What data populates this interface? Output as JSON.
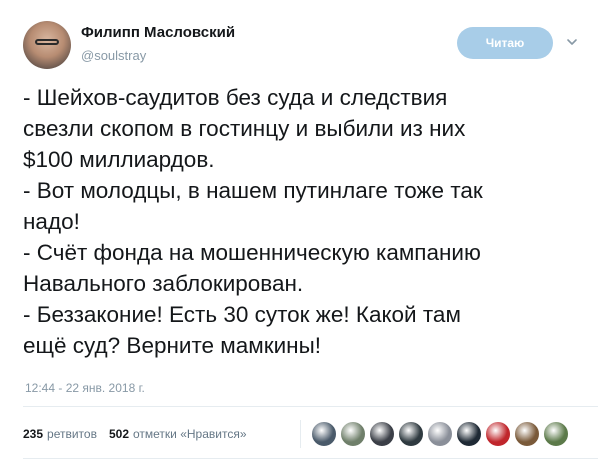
{
  "author": {
    "display_name": "Филипп Масловский",
    "handle": "@soulstray"
  },
  "follow_button": {
    "label": "Читаю"
  },
  "tweet": {
    "lines": [
      "- Шейхов-саудитов без суда и следствия",
      "свезли скопом в гостинцу и выбили из них",
      "$100 миллиардов.",
      "- Вот молодцы, в нашем путинлаге тоже так",
      "надо!",
      "- Счёт фонда на мошенническую кампанию",
      "Навального заблокирован.",
      "- Беззаконие! Есть 30 суток же! Какой там",
      "ещё суд? Верните мамкины!"
    ],
    "timestamp": "12:44 - 22 янв. 2018 г."
  },
  "stats": {
    "retweets_count": "235",
    "retweets_label": "ретвитов",
    "likes_count": "502",
    "likes_label": "отметки «Нравится»"
  },
  "likers": [
    {
      "name": "liker-avatar-1",
      "color": "#4a5a6a"
    },
    {
      "name": "liker-avatar-2",
      "color": "#6f7f6a"
    },
    {
      "name": "liker-avatar-3",
      "color": "#3b3f47"
    },
    {
      "name": "liker-avatar-4",
      "color": "#2f3a40"
    },
    {
      "name": "liker-avatar-5",
      "color": "#8a8f99"
    },
    {
      "name": "liker-avatar-6",
      "color": "#1f2a35"
    },
    {
      "name": "liker-avatar-7",
      "color": "#c0262c"
    },
    {
      "name": "liker-avatar-8",
      "color": "#7a5a3a"
    },
    {
      "name": "liker-avatar-9",
      "color": "#5c7a4a"
    }
  ],
  "colors": {
    "follow_button_bg": "#a8cde8",
    "secondary_text": "#8899a6"
  }
}
